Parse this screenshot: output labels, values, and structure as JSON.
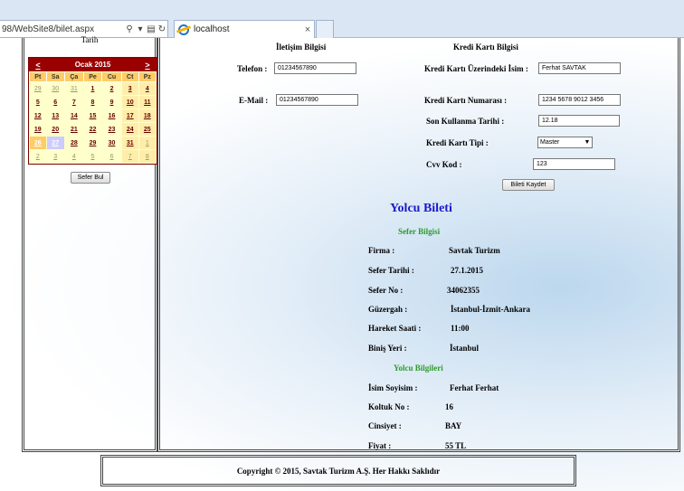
{
  "browser": {
    "url": "98/WebSite8/bilet.aspx",
    "tab_title": "localhost",
    "tab_close": "×",
    "search_glyph": "⚲",
    "dropdown_glyph": "▾",
    "compat_glyph": "▤",
    "refresh_glyph": "↻"
  },
  "calendar": {
    "label": "Tarih",
    "prev": "<",
    "next": ">",
    "month": "Ocak 2015",
    "weekdays": [
      "Pt",
      "Sa",
      "Ça",
      "Pe",
      "Cu",
      "Ct",
      "Pz"
    ],
    "weeks": [
      [
        "29",
        "30",
        "31",
        "1",
        "2",
        "3",
        "4"
      ],
      [
        "5",
        "6",
        "7",
        "8",
        "9",
        "10",
        "11"
      ],
      [
        "12",
        "13",
        "14",
        "15",
        "16",
        "17",
        "18"
      ],
      [
        "19",
        "20",
        "21",
        "22",
        "23",
        "24",
        "25"
      ],
      [
        "26",
        "27",
        "28",
        "29",
        "30",
        "31",
        "1"
      ],
      [
        "2",
        "3",
        "4",
        "5",
        "6",
        "7",
        "8"
      ]
    ],
    "search_button": "Sefer Bul"
  },
  "contact": {
    "heading": "İletişim Bilgisi",
    "phone_label": "Telefon :",
    "phone_value": "01234567890",
    "email_label": "E-Mail :",
    "email_value": "01234567890"
  },
  "card": {
    "heading": "Kredi Kartı Bilgisi",
    "name_label": "Kredi Kartı Üzerindeki İsim :",
    "name_value": "Ferhat SAVTAK",
    "number_label": "Kredi Kartı Numarası :",
    "number_value": "1234 5678 9012 3456",
    "expiry_label": "Son Kullanma Tarihi :",
    "expiry_value": "12.18",
    "type_label": "Kredi Kartı Tipi  :",
    "type_value": "Master",
    "cvv_label": "Cvv Kod :",
    "cvv_value": "123",
    "save_button": "Bileti Kaydet"
  },
  "ticket": {
    "title": "Yolcu Bileti",
    "trip_heading": "Sefer Bilgisi",
    "company_label": "Firma :",
    "company_value": "Savtak Turizm",
    "date_label": "Sefer Tarihi :",
    "date_value": "27.1.2015",
    "no_label": "Sefer No :",
    "no_value": "34062355",
    "route_label": "Güzergah :",
    "route_value": "İstanbul-İzmit-Ankara",
    "time_label": "Hareket Saati :",
    "time_value": "11:00",
    "boarding_label": "Biniş Yeri :",
    "boarding_value": "İstanbul",
    "passenger_heading": "Yolcu Bilgileri",
    "name_label": "İsim Soyisim :",
    "name_value": "Ferhat Ferhat",
    "seat_label": "Koltuk No :",
    "seat_value": "16",
    "gender_label": "Cinsiyet :",
    "gender_value": "BAY",
    "price_label": "Fiyat :",
    "price_value": "55 TL"
  },
  "footer": {
    "text": "Copyright © 2015, Savtak Turizm A.Ş. Her Hakkı Saklıdır"
  },
  "colors": {
    "calendar_header": "#990000",
    "calendar_weekday_bg": "#ffcc66",
    "ticket_title": "#1a1acc",
    "section_green": "#2e9a2e"
  }
}
